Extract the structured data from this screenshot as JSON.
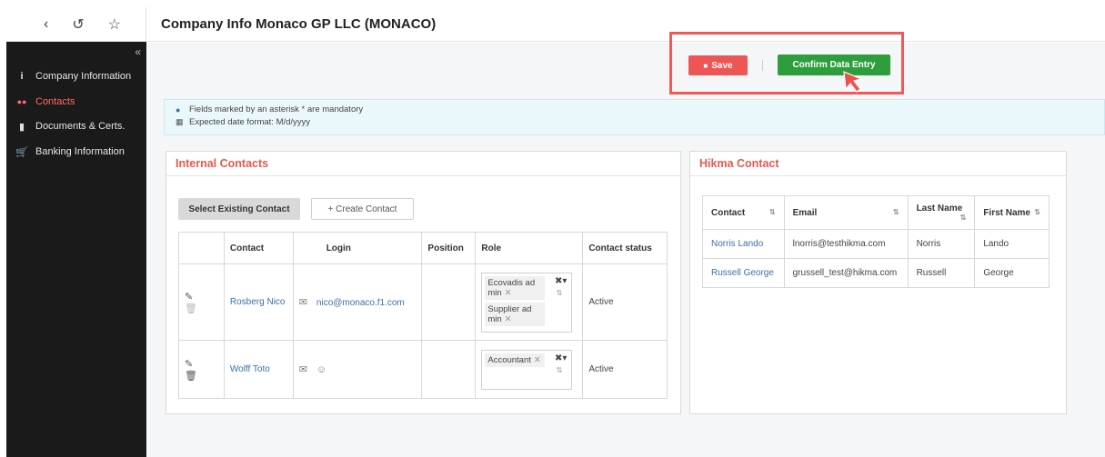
{
  "topbar": {
    "back_icon": "‹",
    "history_icon": "↺",
    "star_icon": "☆",
    "title": "Company Info Monaco GP LLC (MONACO)"
  },
  "sidebar": {
    "collapse_icon": "«",
    "items": [
      {
        "label": "Company Information",
        "icon": "info-icon",
        "glyph": "i",
        "active": false
      },
      {
        "label": "Contacts",
        "icon": "users-icon",
        "glyph": "👥",
        "active": true
      },
      {
        "label": "Documents & Certs.",
        "icon": "document-icon",
        "glyph": "▬",
        "active": false
      },
      {
        "label": "Banking Information",
        "icon": "cart-icon",
        "glyph": "🛒",
        "active": false
      }
    ]
  },
  "actions": {
    "save_label": "Save",
    "confirm_label": "Confirm Data Entry"
  },
  "info": {
    "mandatory_text": "Fields marked by an asterisk * are mandatory",
    "date_format_text": "Expected date format: M/d/yyyy"
  },
  "internal": {
    "title": "Internal Contacts",
    "select_existing_label": "Select Existing Contact",
    "create_contact_label": "+ Create Contact",
    "columns": [
      "Contact",
      "Login",
      "Position",
      "Role",
      "Contact status"
    ],
    "rows": [
      {
        "contact": "Rosberg Nico",
        "login": "nico@monaco.f1.com",
        "position": "",
        "roles": [
          "Ecovadis ad min",
          "Supplier ad min"
        ],
        "status": "Active"
      },
      {
        "contact": "Wolff Toto",
        "login": "",
        "position": "",
        "roles": [
          "Accountant"
        ],
        "status": "Active"
      }
    ]
  },
  "hikma": {
    "title": "Hikma Contact",
    "columns": [
      "Contact",
      "Email",
      "Last Name",
      "First Name"
    ],
    "rows": [
      {
        "contact": "Norris Lando",
        "email": "lnorris@testhikma.com",
        "last": "Norris",
        "first": "Lando"
      },
      {
        "contact": "Russell George",
        "email": "grussell_test@hikma.com",
        "last": "Russell",
        "first": "George"
      }
    ]
  },
  "colors": {
    "accent_red": "#ef5554",
    "confirm_green": "#2e9e3d",
    "sidebar_bg": "#1a1a1a",
    "highlight_border": "#ec5a5a"
  }
}
